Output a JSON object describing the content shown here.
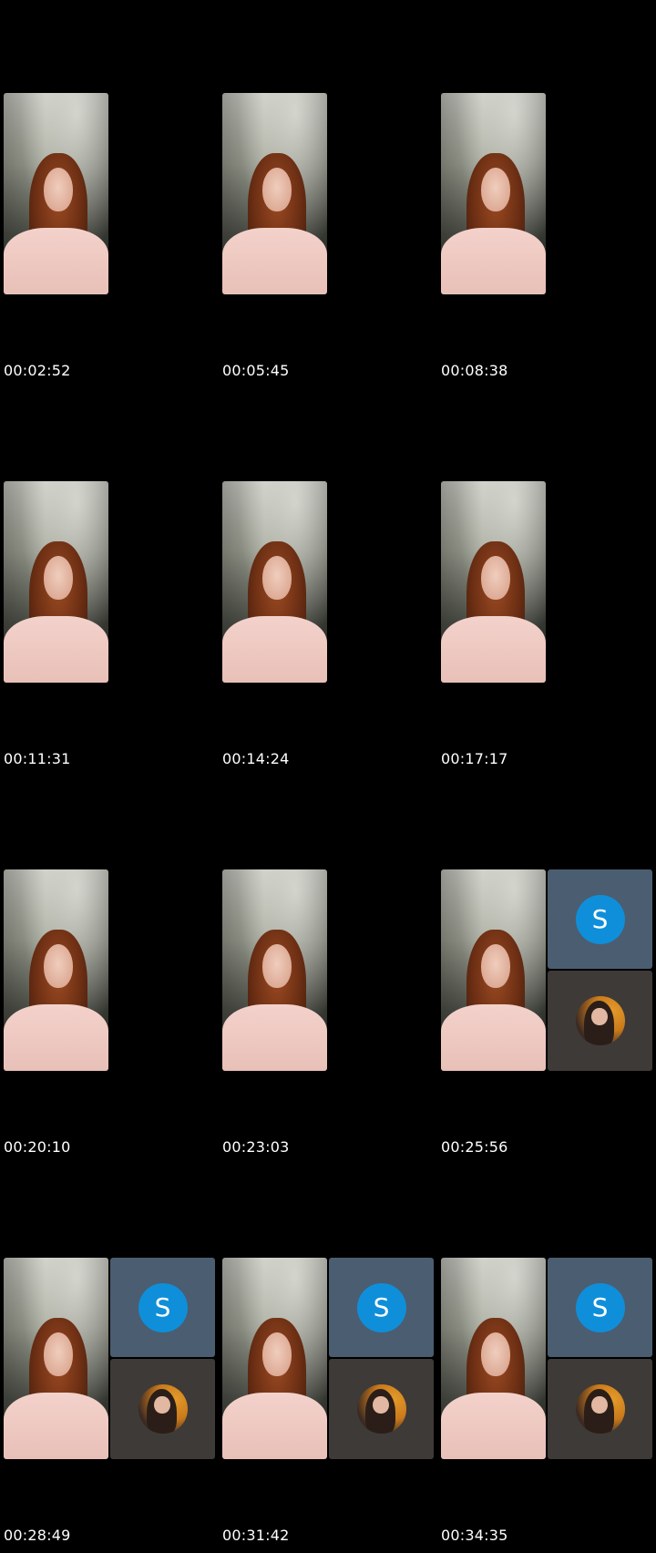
{
  "thumbnails": [
    {
      "timestamp": "00:02:52",
      "has_participants": false
    },
    {
      "timestamp": "00:05:45",
      "has_participants": false
    },
    {
      "timestamp": "00:08:38",
      "has_participants": false
    },
    {
      "timestamp": "00:11:31",
      "has_participants": false
    },
    {
      "timestamp": "00:14:24",
      "has_participants": false
    },
    {
      "timestamp": "00:17:17",
      "has_participants": false
    },
    {
      "timestamp": "00:20:10",
      "has_participants": false
    },
    {
      "timestamp": "00:23:03",
      "has_participants": false
    },
    {
      "timestamp": "00:25:56",
      "has_participants": true,
      "avatar_letter": "S"
    },
    {
      "timestamp": "00:28:49",
      "has_participants": true,
      "avatar_letter": "S"
    },
    {
      "timestamp": "00:31:42",
      "has_participants": true,
      "avatar_letter": "S"
    },
    {
      "timestamp": "00:34:35",
      "has_participants": true,
      "avatar_letter": "S"
    }
  ],
  "colors": {
    "background": "#000000",
    "avatar_blue": "#0f8fd9",
    "participant_tile": "#4b5d70",
    "self_tile": "#3e3a37",
    "timestamp_text": "#ffffff"
  }
}
